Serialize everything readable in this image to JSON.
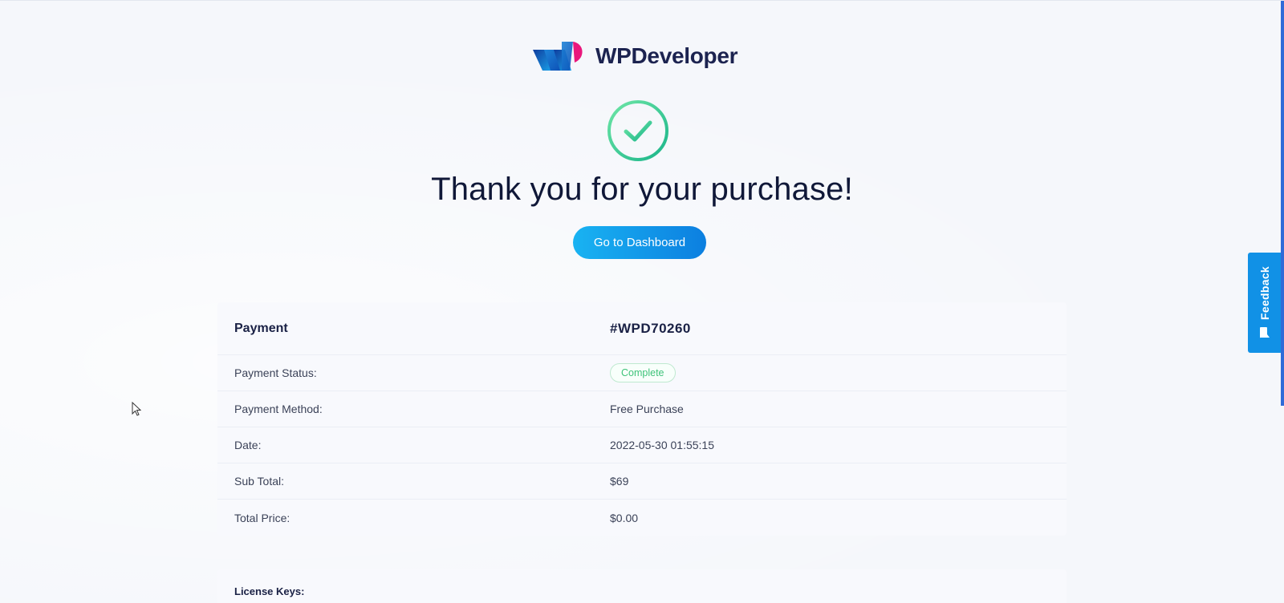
{
  "brand": {
    "name": "WPDeveloper"
  },
  "header": {
    "title": "Thank you for your purchase!"
  },
  "actions": {
    "dashboard_label": "Go to Dashboard"
  },
  "payment": {
    "label": "Payment",
    "id": "#WPD70260",
    "rows": [
      {
        "label": "Payment Status:",
        "value": "Complete",
        "type": "badge"
      },
      {
        "label": "Payment Method:",
        "value": "Free Purchase"
      },
      {
        "label": "Date:",
        "value": "2022-05-30 01:55:15"
      },
      {
        "label": "Sub Total:",
        "value": "$69"
      },
      {
        "label": "Total Price:",
        "value": "$0.00"
      }
    ]
  },
  "license": {
    "label": "License Keys:"
  },
  "feedback": {
    "label": "Feedback",
    "icon": "chat-bubble-icon"
  },
  "colors": {
    "accent": "#1191e6",
    "success": "#3fc37a",
    "brand_blue": "#1c6fd8",
    "brand_pink": "#e9177c"
  },
  "icons": {
    "success": "check-circle-icon",
    "logo": "wpdeveloper-logo-icon"
  }
}
